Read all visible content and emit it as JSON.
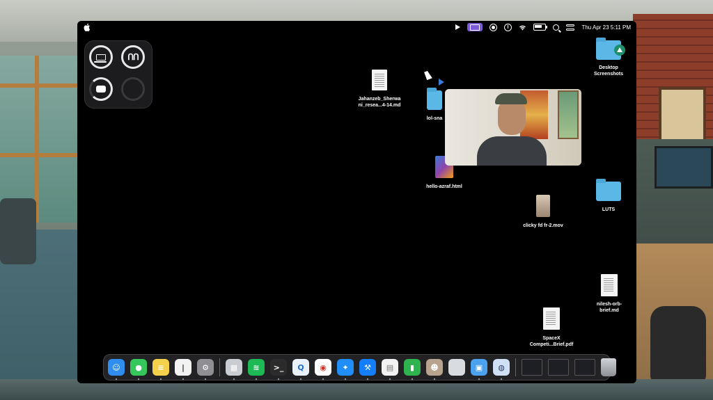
{
  "menubar": {
    "clock": "Thu Apr 23  5:11 PM",
    "icons": [
      "apple-icon",
      "play-icon",
      "screen-share-icon",
      "circle-dot-icon",
      "power-icon",
      "wifi-icon",
      "battery-icon",
      "search-icon",
      "control-center-icon"
    ],
    "accent": "#7b5bd6"
  },
  "battery_widget": {
    "devices": [
      "laptop-icon",
      "airpods-icon",
      "airpods-case-icon",
      "empty-slot"
    ]
  },
  "desktop": {
    "items": [
      {
        "label": "Jahanzeb_Sherwa\nni_resea...4-14.md",
        "icon": "markdown-doc-icon"
      },
      {
        "label": "lol-sna",
        "icon": "folder-icon"
      },
      {
        "label": "hello-azraf.html",
        "icon": "html-file-icon"
      },
      {
        "label": "clicky fd fr-2.mov",
        "icon": "video-file-icon"
      },
      {
        "label": "Desktop\nScreenshots",
        "icon": "folder-icon"
      },
      {
        "label": "LUTS",
        "icon": "folder-icon"
      },
      {
        "label": "nilesh-orb-\nbrief.md",
        "icon": "markdown-doc-icon"
      },
      {
        "label": "SpaceX\nCompeti...Brief.pdf",
        "icon": "pdf-doc-icon"
      }
    ]
  },
  "video_overlay": {
    "content": "webcam-feed"
  },
  "dock": {
    "apps": [
      {
        "name": "Finder",
        "icon": "finder-icon",
        "color": "#2f8ef0",
        "running": true
      },
      {
        "name": "Messages",
        "icon": "messages-icon",
        "color": "#35c759",
        "running": true
      },
      {
        "name": "Notes",
        "icon": "notes-icon",
        "color": "#f5d04a",
        "running": true
      },
      {
        "name": "Text Editor",
        "icon": "text-editor-icon",
        "color": "#f2f2f2",
        "running": true
      },
      {
        "name": "System Settings",
        "icon": "settings-icon",
        "color": "#8e8e93",
        "running": true
      },
      {
        "name": "App Switcher",
        "icon": "window-manager-icon",
        "color": "#c9ccd2",
        "running": true
      },
      {
        "name": "Spotify",
        "icon": "spotify-icon",
        "color": "#1db954",
        "running": true
      },
      {
        "name": "Terminal",
        "icon": "terminal-icon",
        "color": "#2b2b2b",
        "running": true
      },
      {
        "name": "Browser",
        "icon": "browser-q-icon",
        "color": "#e9f1fb",
        "running": true
      },
      {
        "name": "Chrome",
        "icon": "chrome-icon",
        "color": "#ffffff",
        "running": true
      },
      {
        "name": "Safari",
        "icon": "safari-icon",
        "color": "#1f8ff7",
        "running": true
      },
      {
        "name": "Xcode",
        "icon": "xcode-icon",
        "color": "#147efb",
        "running": true
      },
      {
        "name": "Spreadsheet",
        "icon": "spreadsheet-icon",
        "color": "#f2f2f2",
        "running": true
      },
      {
        "name": "Numbers",
        "icon": "numbers-icon",
        "color": "#2fb34e",
        "running": true
      },
      {
        "name": "Contacts",
        "icon": "contacts-icon",
        "color": "#b8a48e",
        "running": true
      },
      {
        "name": "Blank App",
        "icon": "blank-app-icon",
        "color": "#d8dbe0",
        "running": false
      },
      {
        "name": "Files",
        "icon": "files-icon",
        "color": "#4aa1ee",
        "running": true
      },
      {
        "name": "Robot App",
        "icon": "robot-icon",
        "color": "#cfe0f7",
        "running": true
      }
    ],
    "recents": [
      "recent-window-1",
      "recent-window-2",
      "recent-window-3"
    ],
    "trash": "trash-icon"
  }
}
